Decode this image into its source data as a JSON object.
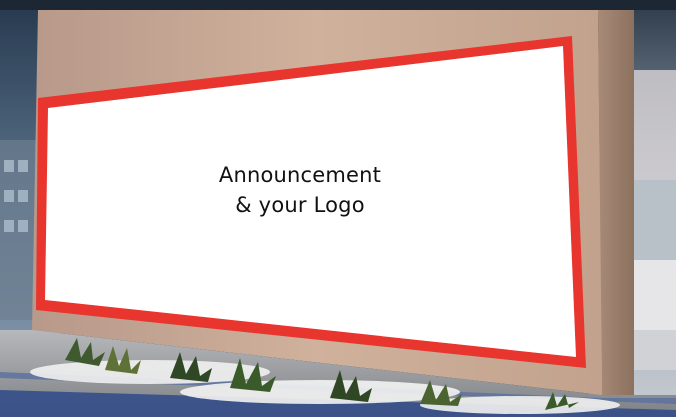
{
  "billboard": {
    "line1": "Announcement",
    "line2": "& your Logo"
  },
  "colors": {
    "frame": "#e8352e",
    "panel": "#ffffff",
    "wall": "#c9ab95",
    "text": "#111111"
  }
}
